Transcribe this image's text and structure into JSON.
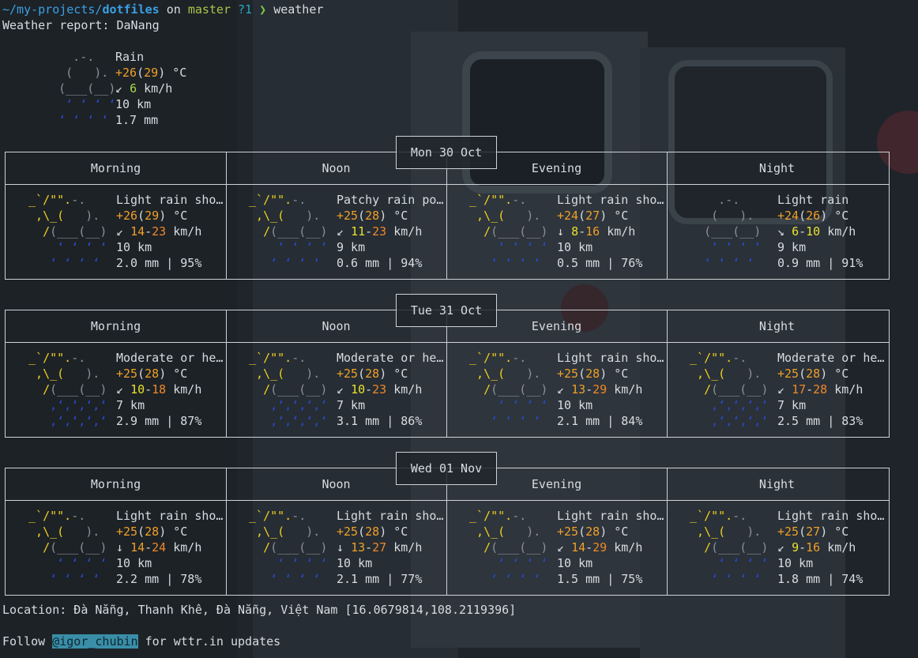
{
  "prompt": {
    "path_prefix": "~/my-projects/",
    "path_dir": "dotfiles",
    "on_word": "on",
    "branch": "master",
    "git_status": "?1",
    "arrow": "❯",
    "command": "weather"
  },
  "report_title": "Weather report: DaNang",
  "current": {
    "condition": "Rain",
    "temp_a": "+26",
    "temp_b": "29",
    "temp_unit": " °C",
    "wind_dir": "↙",
    "wind": "6",
    "wind_unit": " km/h",
    "visibility": "10 km",
    "precip": "1.7 mm"
  },
  "periods": [
    "Morning",
    "Noon",
    "Evening",
    "Night"
  ],
  "days": [
    {
      "label": "Mon 30 Oct",
      "slots": [
        {
          "cond": "Light rain sho…",
          "t1": "+26",
          "t2": "29",
          "dir": "↙",
          "w1": "14",
          "w2": "23",
          "vis": "10 km",
          "rain": "2.0 mm | 95%"
        },
        {
          "cond": "Patchy rain po…",
          "t1": "+25",
          "t2": "28",
          "dir": "↙",
          "w1": "11",
          "w2": "23",
          "vis": "9 km",
          "rain": "0.6 mm | 94%"
        },
        {
          "cond": "Light rain sho…",
          "t1": "+24",
          "t2": "27",
          "dir": "↓",
          "w1": "8",
          "w2": "16",
          "vis": "10 km",
          "rain": "0.5 mm | 76%"
        },
        {
          "cond": "Light rain",
          "t1": "+24",
          "t2": "26",
          "dir": "↘",
          "w1": "6",
          "w2": "10",
          "vis": "9 km",
          "rain": "0.9 mm | 91%"
        }
      ]
    },
    {
      "label": "Tue 31 Oct",
      "slots": [
        {
          "cond": "Moderate or he…",
          "t1": "+25",
          "t2": "28",
          "dir": "↙",
          "w1": "10",
          "w2": "18",
          "vis": "7 km",
          "rain": "2.9 mm | 87%"
        },
        {
          "cond": "Moderate or he…",
          "t1": "+25",
          "t2": "28",
          "dir": "↙",
          "w1": "10",
          "w2": "23",
          "vis": "7 km",
          "rain": "3.1 mm | 86%"
        },
        {
          "cond": "Light rain sho…",
          "t1": "+25",
          "t2": "28",
          "dir": "↙",
          "w1": "13",
          "w2": "29",
          "vis": "10 km",
          "rain": "2.1 mm | 84%"
        },
        {
          "cond": "Moderate or he…",
          "t1": "+25",
          "t2": "28",
          "dir": "↙",
          "w1": "17",
          "w2": "28",
          "vis": "7 km",
          "rain": "2.5 mm | 83%"
        }
      ]
    },
    {
      "label": "Wed 01 Nov",
      "slots": [
        {
          "cond": "Light rain sho…",
          "t1": "+25",
          "t2": "28",
          "dir": "↓",
          "w1": "14",
          "w2": "24",
          "vis": "10 km",
          "rain": "2.2 mm | 78%"
        },
        {
          "cond": "Light rain sho…",
          "t1": "+25",
          "t2": "28",
          "dir": "↓",
          "w1": "13",
          "w2": "27",
          "vis": "10 km",
          "rain": "2.1 mm | 77%"
        },
        {
          "cond": "Light rain sho…",
          "t1": "+25",
          "t2": "28",
          "dir": "↙",
          "w1": "14",
          "w2": "29",
          "vis": "10 km",
          "rain": "1.5 mm | 75%"
        },
        {
          "cond": "Light rain sho…",
          "t1": "+25",
          "t2": "27",
          "dir": "↙",
          "w1": "9",
          "w2": "16",
          "vis": "10 km",
          "rain": "1.8 mm | 74%"
        }
      ]
    }
  ],
  "location_line": "Location: Đà Nẵng, Thanh Khê, Đà Nẵng, Việt Nam [16.0679814,108.2119396]",
  "follow": {
    "before": "Follow ",
    "handle": "@igor_chubin",
    "after": " for wttr.in updates"
  },
  "colors": {
    "path": "#3aa0e4",
    "branch": "#a6c64a",
    "temp": "#f0a028",
    "wind_low": "#e8e030",
    "rain_drops": "#2a4bd6",
    "sun": "#f0d020"
  }
}
